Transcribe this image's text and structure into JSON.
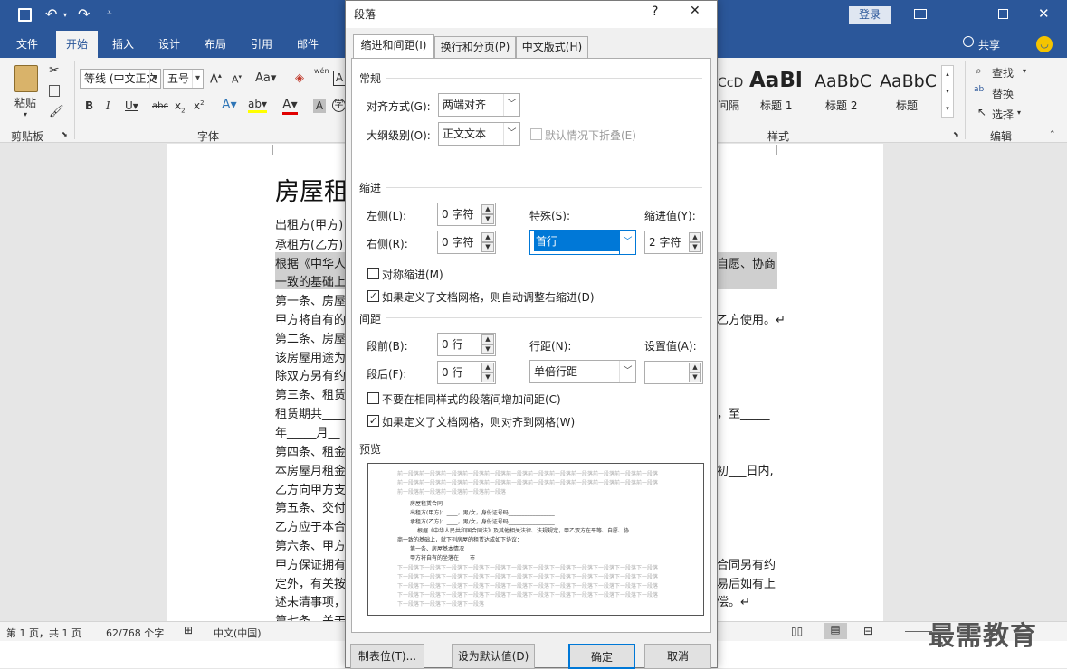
{
  "titlebar": {
    "login": "登录"
  },
  "tabs": [
    "文件",
    "开始",
    "插入",
    "设计",
    "布局",
    "引用",
    "邮件"
  ],
  "share": "共享",
  "ribbon": {
    "paste": "粘贴",
    "clipboard": "剪贴板",
    "font_name": "等线 (中文正文",
    "font_size": "五号",
    "font_group": "字体",
    "phonetic": "wén",
    "styles": [
      {
        "preview": "AaBl",
        "name": "标题 1"
      },
      {
        "preview": "AaBbC",
        "name": "标题 2"
      },
      {
        "preview": "AaBbC",
        "name": "标题"
      }
    ],
    "style_partial_top": "CcD",
    "style_partial_name": "间隔",
    "styles_group": "样式",
    "find": "查找",
    "replace": "替换",
    "select": "选择",
    "edit_group": "编辑"
  },
  "document": {
    "title": "房屋租",
    "left_lines": [
      "出租方(甲方)",
      "承租方(乙方)",
      "根据《中华人",
      "一致的基础上",
      "第一条、房屋",
      "甲方将自有的",
      "第二条、房屋",
      "该房屋用途为",
      "除双方另有约",
      "第三条、租赁",
      "租赁期共____",
      "年_____月__",
      "第四条、租金",
      "本房屋月租金",
      "乙方向甲方支",
      "第五条、交付",
      "乙方应于本合",
      "第六条、甲方",
      "甲方保证拥有",
      "定外，有关按",
      "述未清事项，",
      "第七条、关于"
    ],
    "right_lines": [
      "自愿、协商",
      "乙方使用。↵",
      "，至_____",
      "初___日内,",
      "合同另有约",
      "易后如有上",
      "偿。↵"
    ]
  },
  "statusbar": {
    "page": "第 1 页，共 1 页",
    "words": "62/768 个字",
    "lang": "中文(中国)"
  },
  "watermark": "最需教育",
  "dialog": {
    "title": "段落",
    "help": "?",
    "close": "✕",
    "tabs": [
      "缩进和间距(I)",
      "换行和分页(P)",
      "中文版式(H)"
    ],
    "general": {
      "section": "常规",
      "align_label": "对齐方式(G):",
      "align_value": "两端对齐",
      "outline_label": "大纲级别(O):",
      "outline_value": "正文文本",
      "collapse_label": "默认情况下折叠(E)"
    },
    "indent": {
      "section": "缩进",
      "left_label": "左侧(L):",
      "left_value": "0 字符",
      "right_label": "右侧(R):",
      "right_value": "0 字符",
      "special_label": "特殊(S):",
      "special_value": "首行",
      "by_label": "缩进值(Y):",
      "by_value": "2 字符",
      "mirror_label": "对称缩进(M)",
      "auto_right_label": "如果定义了文档网格，则自动调整右缩进(D)"
    },
    "spacing": {
      "section": "间距",
      "before_label": "段前(B):",
      "before_value": "0 行",
      "after_label": "段后(F):",
      "after_value": "0 行",
      "line_label": "行距(N):",
      "line_value": "单倍行距",
      "at_label": "设置值(A):",
      "at_value": "",
      "no_space_label": "不要在相同样式的段落间增加间距(C)",
      "snap_label": "如果定义了文档网格，则对齐到网格(W)"
    },
    "preview": {
      "section": "预览",
      "before_lines": [
        "前一段落前一段落前一段落前一段落前一段落前一段落前一段落前一段落前一段落前一段落前一段落前一段落",
        "前一段落前一段落前一段落前一段落前一段落前一段落前一段落前一段落前一段落前一段落前一段落前一段落",
        "前一段落前一段落前一段落前一段落前一段落"
      ],
      "text_lines": [
        "房屋租赁合同",
        "出租方(甲方)：____，男/女，身份证号码_________________",
        "承租方(乙方)：____，男/女，身份证号码_________________",
        "根据《中华人民共和国合同法》及其他相关法律、法规规定，甲乙双方在平等、自愿、协",
        "商一致的基础上，就下列房屋的租赁达成如下协议：",
        "第一条、房屋基本情况",
        "甲方将自有的坐落在____市"
      ],
      "after_lines": [
        "下一段落下一段落下一段落下一段落下一段落下一段落下一段落下一段落下一段落下一段落下一段落下一段落",
        "下一段落下一段落下一段落下一段落下一段落下一段落下一段落下一段落下一段落下一段落下一段落下一段落",
        "下一段落下一段落下一段落下一段落下一段落下一段落下一段落下一段落下一段落下一段落下一段落下一段落",
        "下一段落下一段落下一段落下一段落下一段落下一段落下一段落下一段落下一段落下一段落下一段落下一段落",
        "下一段落下一段落下一段落下一段落"
      ]
    },
    "buttons": {
      "tabs": "制表位(T)...",
      "default": "设为默认值(D)",
      "ok": "确定",
      "cancel": "取消"
    }
  }
}
